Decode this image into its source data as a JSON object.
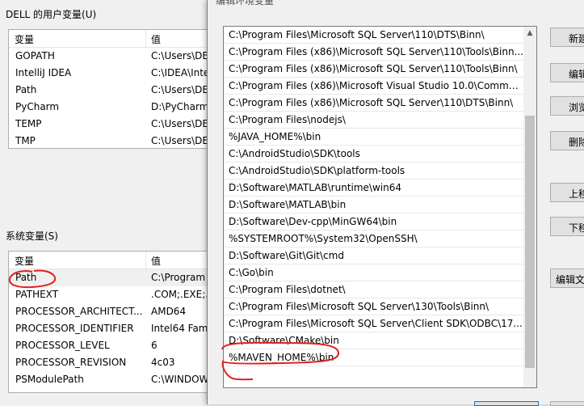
{
  "user_vars": {
    "group_label": "DELL 的用户变量(U)",
    "col_var": "变量",
    "col_val": "值",
    "rows": [
      {
        "name": "GOPATH",
        "value": "C:\\Users\\DE"
      },
      {
        "name": "IntelliJ IDEA",
        "value": "C:\\IDEA\\Inte"
      },
      {
        "name": "Path",
        "value": "C:\\Users\\DE"
      },
      {
        "name": "PyCharm",
        "value": "D:\\PyCharm"
      },
      {
        "name": "TEMP",
        "value": "C:\\Users\\DE"
      },
      {
        "name": "TMP",
        "value": "C:\\Users\\DE"
      }
    ]
  },
  "sys_vars": {
    "group_label": "系统变量(S)",
    "col_var": "变量",
    "col_val": "值",
    "rows": [
      {
        "name": "Path",
        "value": "C:\\Program"
      },
      {
        "name": "PATHEXT",
        "value": ".COM;.EXE;."
      },
      {
        "name": "PROCESSOR_ARCHITECT...",
        "value": "AMD64"
      },
      {
        "name": "PROCESSOR_IDENTIFIER",
        "value": "Intel64 Fami"
      },
      {
        "name": "PROCESSOR_LEVEL",
        "value": "6"
      },
      {
        "name": "PROCESSOR_REVISION",
        "value": "4c03"
      },
      {
        "name": "PSModulePath",
        "value": "C:\\WINDOW"
      }
    ]
  },
  "edit_dialog": {
    "title": "编辑环境变量",
    "paths": [
      "C:\\Program Files\\Microsoft SQL Server\\110\\DTS\\Binn\\",
      "C:\\Program Files (x86)\\Microsoft SQL Server\\110\\Tools\\Binn...",
      "C:\\Program Files (x86)\\Microsoft SQL Server\\110\\Tools\\Binn\\",
      "C:\\Program Files (x86)\\Microsoft Visual Studio 10.0\\Common...",
      "C:\\Program Files (x86)\\Microsoft SQL Server\\110\\DTS\\Binn\\",
      "C:\\Program Files\\nodejs\\",
      "%JAVA_HOME%\\bin",
      "C:\\AndroidStudio\\SDK\\tools",
      "C:\\AndroidStudio\\SDK\\platform-tools",
      "D:\\Software\\MATLAB\\runtime\\win64",
      "D:\\Software\\MATLAB\\bin",
      "D:\\Software\\Dev-cpp\\MinGW64\\bin",
      "%SYSTEMROOT%\\System32\\OpenSSH\\",
      "D:\\Software\\Git\\Git\\cmd",
      "C:\\Go\\bin",
      "C:\\Program Files\\dotnet\\",
      "C:\\Program Files\\Microsoft SQL Server\\130\\Tools\\Binn\\",
      "C:\\Program Files\\Microsoft SQL Server\\Client SDK\\ODBC\\17...",
      "D:\\Software\\CMake\\bin",
      "%MAVEN_HOME%\\bin"
    ],
    "buttons": {
      "new": "新建(N)",
      "edit": "编辑(E)",
      "browse": "浏览(B)...",
      "delete": "删除(D)",
      "move_up": "上移(U)",
      "move_down": "下移(O)",
      "edit_text": "编辑文本(T)..."
    }
  },
  "colors": {
    "annotation": "#e02020",
    "dialog_bg": "#f0f0f0"
  }
}
